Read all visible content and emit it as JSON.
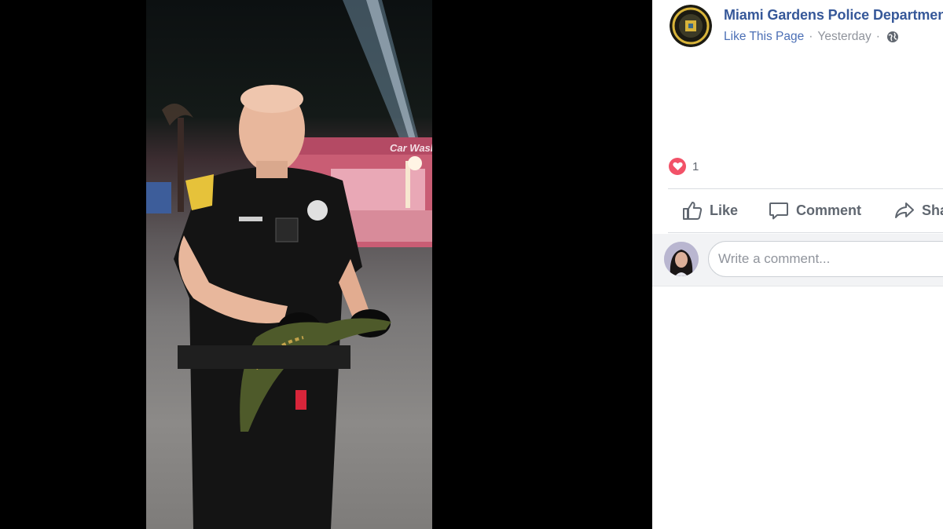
{
  "post": {
    "page_name": "Miami Gardens Police Department",
    "like_page_label": "Like This Page",
    "separator": "·",
    "timestamp": "Yesterday",
    "privacy_icon": "globe-icon",
    "page_avatar_icon": "police-badge-icon"
  },
  "photo": {
    "storefront_sign": "Car Wash",
    "description_icon": "officer-holding-alligator-photo"
  },
  "reactions": {
    "icon": "heart-icon",
    "count": "1",
    "color": "#f25268"
  },
  "actions": {
    "like": "Like",
    "comment": "Comment",
    "share": "Share"
  },
  "comment_box": {
    "placeholder": "Write a comment..."
  },
  "colors": {
    "link": "#365899",
    "meta": "#90949c",
    "action": "#606770",
    "viewer_bg": "#000000"
  }
}
